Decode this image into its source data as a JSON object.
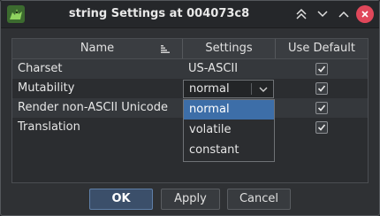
{
  "window": {
    "title": "string Settings at 004073c8",
    "controls": {
      "shade": "chevrons-up-icon",
      "minimize": "chevron-down-icon",
      "maximize": "chevron-up-icon",
      "close": "close-icon"
    }
  },
  "table": {
    "columns": [
      "Name",
      "Settings",
      "Use Default"
    ],
    "rows": [
      {
        "name": "Charset",
        "setting": "US-ASCII",
        "use_default": true
      },
      {
        "name": "Mutability",
        "setting": "normal",
        "use_default": true
      },
      {
        "name": "Render non-ASCII Unicode",
        "setting": "",
        "use_default": true
      },
      {
        "name": "Translation",
        "setting": "",
        "use_default": true
      }
    ]
  },
  "dropdown": {
    "current": "normal",
    "options": [
      "normal",
      "volatile",
      "constant"
    ],
    "selected": "normal"
  },
  "buttons": {
    "ok": "OK",
    "apply": "Apply",
    "cancel": "Cancel"
  },
  "colors": {
    "accent": "#3d6ea8",
    "close": "#e0475a",
    "background": "#2f3134"
  }
}
